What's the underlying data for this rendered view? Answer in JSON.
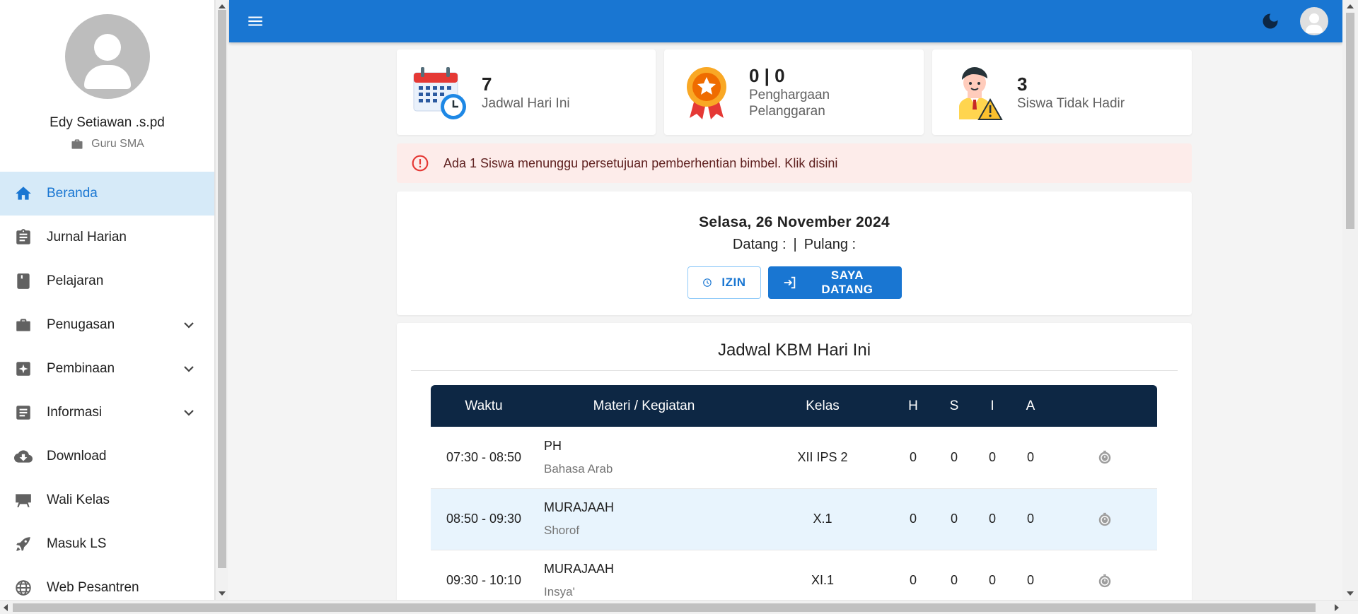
{
  "user": {
    "name": "Edy Setiawan .s.pd",
    "role": "Guru SMA"
  },
  "nav": [
    {
      "label": "Beranda",
      "icon": "home-icon",
      "active": true,
      "expandable": false
    },
    {
      "label": "Jurnal Harian",
      "icon": "clipboard-icon",
      "expandable": false
    },
    {
      "label": "Pelajaran",
      "icon": "book-icon",
      "expandable": false
    },
    {
      "label": "Penugasan",
      "icon": "briefcase-icon",
      "expandable": true
    },
    {
      "label": "Pembinaan",
      "icon": "sparkle-icon",
      "expandable": true
    },
    {
      "label": "Informasi",
      "icon": "article-icon",
      "expandable": true
    },
    {
      "label": "Download",
      "icon": "cloud-download-icon",
      "expandable": false
    },
    {
      "label": "Wali Kelas",
      "icon": "easel-icon",
      "expandable": false
    },
    {
      "label": "Masuk LS",
      "icon": "rocket-icon",
      "expandable": false
    },
    {
      "label": "Web Pesantren",
      "icon": "globe-icon",
      "expandable": false
    }
  ],
  "stats": [
    {
      "value": "7",
      "label_line1": "Jadwal Hari Ini",
      "label_line2": ""
    },
    {
      "value": "0 | 0",
      "label_line1": "Penghargaan",
      "label_line2": "Pelanggaran"
    },
    {
      "value": "3",
      "label_line1": "Siswa Tidak Hadir",
      "label_line2": ""
    }
  ],
  "alert": {
    "text": "Ada 1 Siswa menunggu persetujuan pemberhentian bimbel. Klik disini"
  },
  "presence": {
    "date": "Selasa, 26 November 2024",
    "datang_label": "Datang :",
    "separator": "|",
    "pulang_label": "Pulang :",
    "izin_label": "IZIN",
    "datang_button_label": "SAYA DATANG"
  },
  "schedule": {
    "title": "Jadwal KBM Hari Ini",
    "headers": [
      "Waktu",
      "Materi / Kegiatan",
      "Kelas",
      "H",
      "S",
      "I",
      "A"
    ],
    "rows": [
      {
        "waktu": "07:30 - 08:50",
        "materi": "PH",
        "mapel": "Bahasa Arab",
        "kelas": "XII IPS 2",
        "h": "0",
        "s": "0",
        "i": "0",
        "a": "0"
      },
      {
        "waktu": "08:50 - 09:30",
        "materi": "MURAJAAH",
        "mapel": "Shorof",
        "kelas": "X.1",
        "h": "0",
        "s": "0",
        "i": "0",
        "a": "0"
      },
      {
        "waktu": "09:30 - 10:10",
        "materi": "MURAJAAH",
        "mapel": "Insya'",
        "kelas": "XI.1",
        "h": "0",
        "s": "0",
        "i": "0",
        "a": "0"
      }
    ]
  },
  "colors": {
    "primary": "#1976d2",
    "table_header": "#0d2744",
    "alert_bg": "#fdecea",
    "active_nav_bg": "#d6eaf8"
  }
}
